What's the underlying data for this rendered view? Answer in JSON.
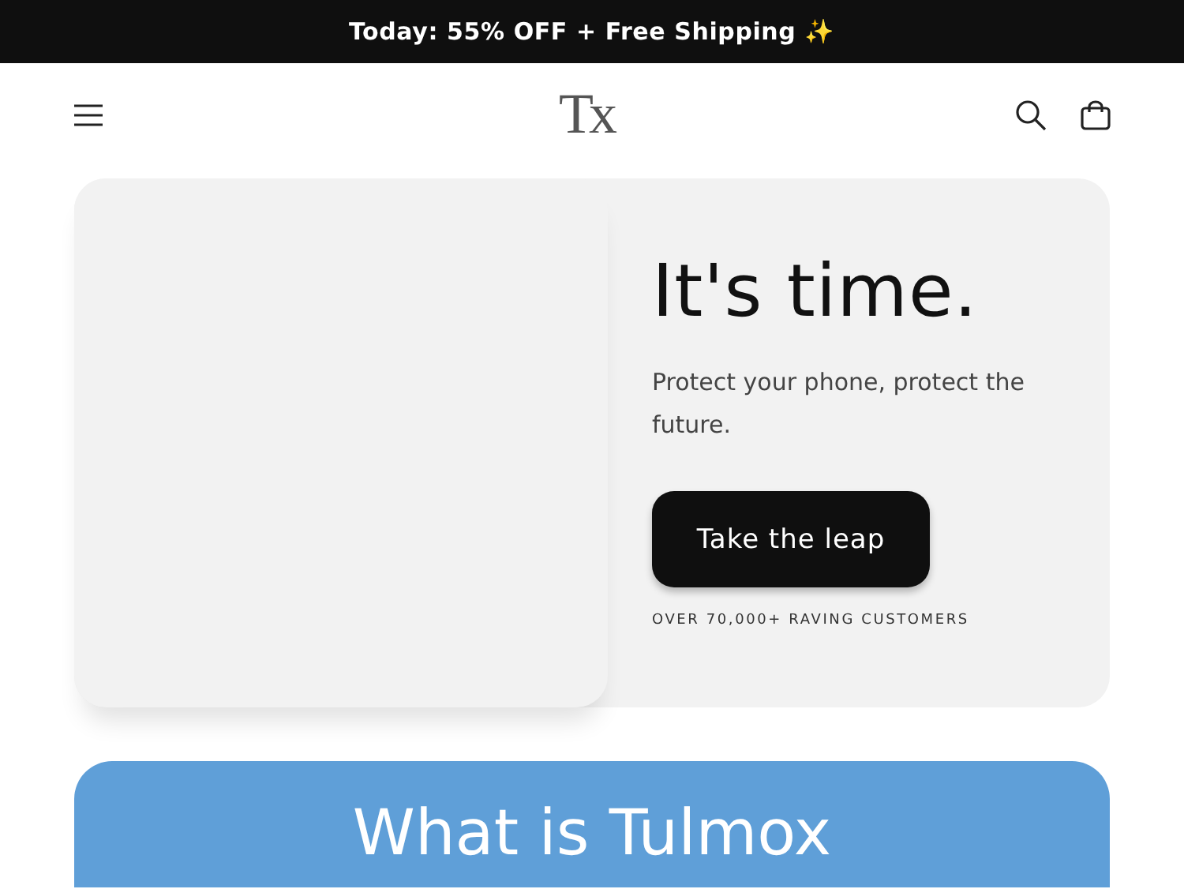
{
  "announcement": "Today: 55% OFF + Free Shipping ✨",
  "header": {
    "logo": "Tx"
  },
  "hero": {
    "title": "It's time.",
    "text": "Protect your phone, protect the future.",
    "button": "Take the leap",
    "caption": "OVER 70,000+ RAVING CUSTOMERS"
  },
  "section": {
    "title": "What is Tulmox"
  }
}
